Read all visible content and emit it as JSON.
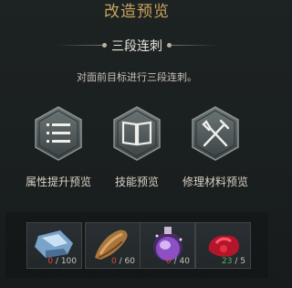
{
  "header": {
    "title": "改造预览"
  },
  "skill": {
    "name": "三段连刺",
    "description": "对面前目标进行三段连刺。"
  },
  "previews": [
    {
      "label": "属性提升预览",
      "icon": "list-icon"
    },
    {
      "label": "技能预览",
      "icon": "book-icon"
    },
    {
      "label": "修理材料预览",
      "icon": "tools-icon"
    }
  ],
  "materials": [
    {
      "icon": "blue-crystal-icon",
      "current": "0",
      "required": "100",
      "sufficient": false
    },
    {
      "icon": "wood-chunk-icon",
      "current": "0",
      "required": "60",
      "sufficient": false
    },
    {
      "icon": "purple-potion-icon",
      "current": "0",
      "required": "40",
      "sufficient": false
    },
    {
      "icon": "red-ore-icon",
      "current": "23",
      "required": "5",
      "sufficient": true
    }
  ]
}
